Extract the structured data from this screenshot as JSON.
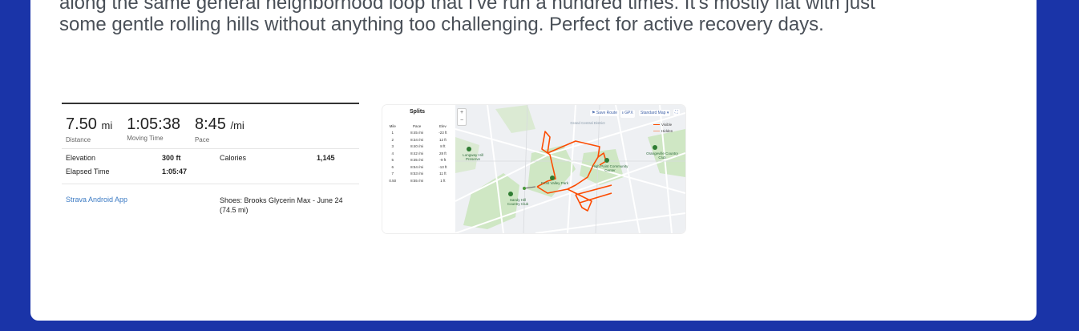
{
  "post": {
    "text_line1": "along the same general neighborhood loop that I've run a hundred times. It's mostly flat with just",
    "text_line2": "some gentle rolling hills without anything too challenging. Perfect for active recovery days."
  },
  "activity": {
    "distance": {
      "value": "7.50",
      "unit": "mi",
      "label": "Distance"
    },
    "moving_time": {
      "value": "1:05:38",
      "label": "Moving Time"
    },
    "pace": {
      "value": "8:45",
      "unit": "/mi",
      "label": "Pace"
    },
    "elevation_label": "Elevation",
    "elevation_value": "300 ft",
    "calories_label": "Calories",
    "calories_value": "1,145",
    "elapsed_label": "Elapsed Time",
    "elapsed_value": "1:05:47",
    "device_link": "Strava Android App",
    "shoes": "Shoes: Brooks Glycerin Max - June 24 (74.5 mi)"
  },
  "splits": {
    "title": "Splits",
    "headers": [
      "Mile",
      "Pace",
      "Elev"
    ],
    "rows": [
      [
        "1",
        "8:45 /mi",
        "-23 ft"
      ],
      [
        "2",
        "8:34 /mi",
        "12 ft"
      ],
      [
        "3",
        "8:40 /mi",
        "8 ft"
      ],
      [
        "4",
        "8:42 /mi",
        "28 ft"
      ],
      [
        "5",
        "8:35 /mi",
        "-9 ft"
      ],
      [
        "6",
        "8:54 /mi",
        "-13 ft"
      ],
      [
        "7",
        "8:53 /mi",
        "11 ft"
      ],
      [
        "0.50",
        "8:55 /mi",
        "1 ft"
      ]
    ]
  },
  "map": {
    "controls": [
      "Save Route",
      "GPX",
      "Standard Map"
    ],
    "legend": [
      "Visible",
      "Hidden"
    ],
    "places": [
      "Grand Central District",
      "High Point Community Center",
      "Frost Valley Park",
      "Sandy Hill Country Club",
      "Orangeville Country Club",
      "Longway Hill Preserve"
    ],
    "route_color": "#fc4c02"
  }
}
